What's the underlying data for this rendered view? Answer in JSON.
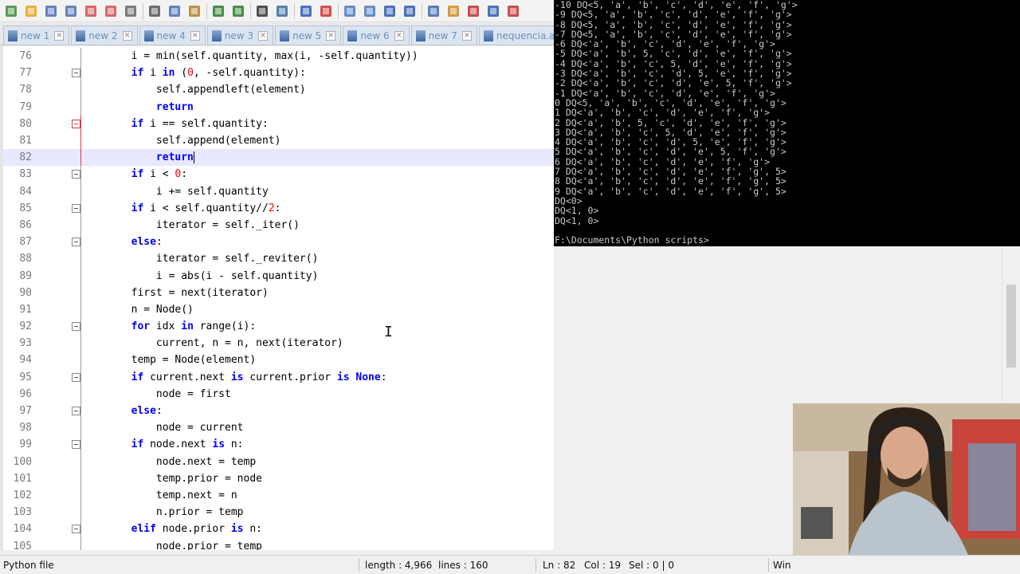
{
  "toolbar": {
    "icons": [
      "new-file-icon",
      "open-folder-icon",
      "save-icon",
      "save-all-icon",
      "close-icon",
      "close-all-icon",
      "print-icon",
      "cut-icon",
      "copy-icon",
      "paste-icon",
      "undo-icon",
      "redo-icon",
      "find-icon",
      "replace-icon",
      "zoom-in-icon",
      "zoom-out-icon",
      "sync-v-icon",
      "sync-h-icon",
      "wrap-icon",
      "show-all-chars-icon",
      "indent-guide-icon",
      "udl-icon",
      "doc-map-icon",
      "function-list-icon",
      "folder-workspace-icon"
    ]
  },
  "tabs": [
    {
      "label": "new 1",
      "active": false
    },
    {
      "label": "new 2",
      "active": false
    },
    {
      "label": "new 4",
      "active": false
    },
    {
      "label": "new 3",
      "active": false
    },
    {
      "label": "new 5",
      "active": false
    },
    {
      "label": "new 6",
      "active": false
    },
    {
      "label": "new 7",
      "active": false
    },
    {
      "label": "nequencia.ahk",
      "active": false
    }
  ],
  "tab_close_glyph": "✕",
  "editor": {
    "lines": [
      {
        "n": "76",
        "fold": "",
        "html": "        i = min(self.quantity, max(i, -self.quantity))"
      },
      {
        "n": "77",
        "fold": "box",
        "html": "        <span class='kw'>if</span> i <span class='kw'>in</span> (<span class='num'>0</span>, -self.quantity):"
      },
      {
        "n": "78",
        "fold": "",
        "html": "            self.appendleft(element)"
      },
      {
        "n": "79",
        "fold": "",
        "html": "            <span class='kw'>return</span>"
      },
      {
        "n": "80",
        "fold": "redbox",
        "html": "        <span class='kw'>if</span> i == self.quantity:"
      },
      {
        "n": "81",
        "fold": "red",
        "html": "            self.append(element)"
      },
      {
        "n": "82",
        "fold": "red",
        "current": true,
        "html": "            <span class='kw'>return</span><span class='caret'></span>"
      },
      {
        "n": "83",
        "fold": "box",
        "html": "        <span class='kw'>if</span> i &lt; <span class='num'>0</span>:"
      },
      {
        "n": "84",
        "fold": "",
        "html": "            i += self.quantity"
      },
      {
        "n": "85",
        "fold": "box",
        "html": "        <span class='kw'>if</span> i &lt; self.quantity//<span class='num'>2</span>:"
      },
      {
        "n": "86",
        "fold": "",
        "html": "            iterator = self._iter()"
      },
      {
        "n": "87",
        "fold": "box",
        "html": "        <span class='kw'>else</span>:"
      },
      {
        "n": "88",
        "fold": "",
        "html": "            iterator = self._reviter()"
      },
      {
        "n": "89",
        "fold": "",
        "html": "            i = abs(i - self.quantity)"
      },
      {
        "n": "90",
        "fold": "",
        "html": "        first = next(iterator)"
      },
      {
        "n": "91",
        "fold": "",
        "html": "        n = Node()"
      },
      {
        "n": "92",
        "fold": "box",
        "html": "        <span class='kw'>for</span> idx <span class='kw'>in</span> range(i):"
      },
      {
        "n": "93",
        "fold": "",
        "html": "            current, n = n, next(iterator)"
      },
      {
        "n": "94",
        "fold": "",
        "html": "        temp = Node(element)"
      },
      {
        "n": "95",
        "fold": "box",
        "html": "        <span class='kw'>if</span> current.next <span class='kw'>is</span> current.prior <span class='kw'>is</span> <span class='kw'>None</span>:"
      },
      {
        "n": "96",
        "fold": "",
        "html": "            node = first"
      },
      {
        "n": "97",
        "fold": "box",
        "html": "        <span class='kw'>else</span>:"
      },
      {
        "n": "98",
        "fold": "",
        "html": "            node = current"
      },
      {
        "n": "99",
        "fold": "box",
        "html": "        <span class='kw'>if</span> node.next <span class='kw'>is</span> n:"
      },
      {
        "n": "100",
        "fold": "",
        "html": "            node.next = temp"
      },
      {
        "n": "101",
        "fold": "",
        "html": "            temp.prior = node"
      },
      {
        "n": "102",
        "fold": "",
        "html": "            temp.next = n"
      },
      {
        "n": "103",
        "fold": "",
        "html": "            n.prior = temp"
      },
      {
        "n": "104",
        "fold": "box",
        "html": "        <span class='kw'>elif</span> node.prior <span class='kw'>is</span> n:"
      },
      {
        "n": "105",
        "fold": "",
        "html": "            node.prior = temp"
      }
    ],
    "text_cursor_glyph": "I"
  },
  "console": {
    "lines": [
      "-10 DQ<5, 'a', 'b', 'c', 'd', 'e', 'f', 'g'>",
      "-9 DQ<5, 'a', 'b', 'c', 'd', 'e', 'f', 'g'>",
      "-8 DQ<5, 'a', 'b', 'c', 'd', 'e', 'f', 'g'>",
      "-7 DQ<5, 'a', 'b', 'c', 'd', 'e', 'f', 'g'>",
      "-6 DQ<'a', 'b', 'c', 'd', 'e', 'f', 'g'>",
      "-5 DQ<'a', 'b', 5, 'c', 'd', 'e', 'f', 'g'>",
      "-4 DQ<'a', 'b', 'c', 5, 'd', 'e', 'f', 'g'>",
      "-3 DQ<'a', 'b', 'c', 'd', 5, 'e', 'f', 'g'>",
      "-2 DQ<'a', 'b', 'c', 'd', 'e', 5, 'f', 'g'>",
      "-1 DQ<'a', 'b', 'c', 'd', 'e', 'f', 'g'>",
      "0 DQ<5, 'a', 'b', 'c', 'd', 'e', 'f', 'g'>",
      "1 DQ<'a', 'b', 'c', 'd', 'e', 'f', 'g'>",
      "2 DQ<'a', 'b', 5, 'c', 'd', 'e', 'f', 'g'>",
      "3 DQ<'a', 'b', 'c', 5, 'd', 'e', 'f', 'g'>",
      "4 DQ<'a', 'b', 'c', 'd', 5, 'e', 'f', 'g'>",
      "5 DQ<'a', 'b', 'c', 'd', 'e', 5, 'f', 'g'>",
      "6 DQ<'a', 'b', 'c', 'd', 'e', 'f', 'g'>",
      "7 DQ<'a', 'b', 'c', 'd', 'e', 'f', 'g', 5>",
      "8 DQ<'a', 'b', 'c', 'd', 'e', 'f', 'g', 5>",
      "9 DQ<'a', 'b', 'c', 'd', 'e', 'f', 'g', 5>",
      "DQ<0>",
      "DQ<1, 0>",
      "DQ<1, 0>",
      "",
      "F:\\Documents\\Python scripts>"
    ]
  },
  "status": {
    "filetype": "Python file",
    "length": "length : 4,966",
    "lines": "lines : 160",
    "ln": "Ln : 82",
    "col": "Col : 19",
    "sel": "Sel : 0 | 0",
    "eol": "Win"
  }
}
